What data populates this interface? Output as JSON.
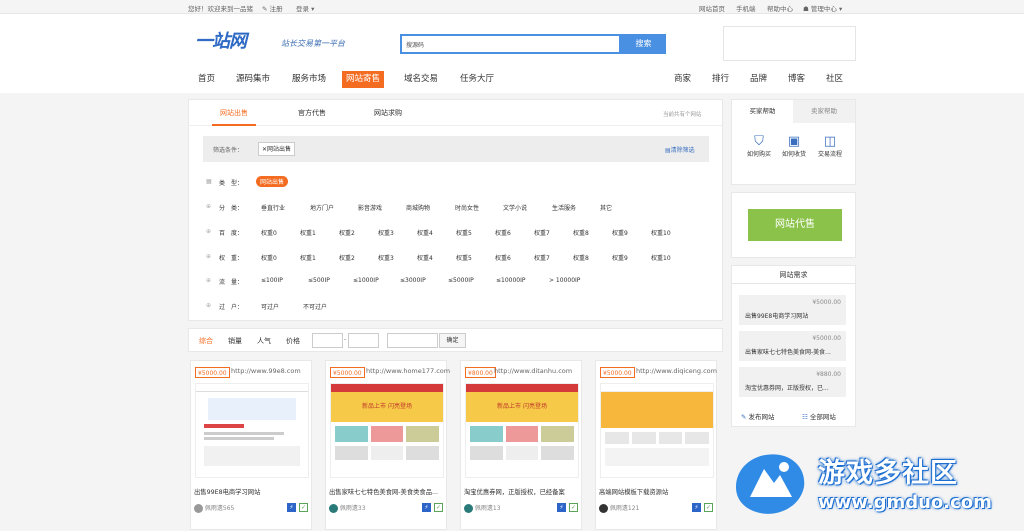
{
  "topbar": {
    "greeting": "您好！欢迎来到一品猪",
    "register": "注册",
    "login": "登录",
    "links": [
      "网站首页",
      "手机端",
      "帮助中心",
      "管理中心"
    ]
  },
  "brand": {
    "logo": "一站网",
    "slogan": "站长交易第一平台"
  },
  "search": {
    "value": "搜源码",
    "button": "搜索"
  },
  "nav": {
    "left": [
      "首页",
      "源码集市",
      "服务市场",
      "网站寄售",
      "域名交易",
      "任务大厅"
    ],
    "right": [
      "商家",
      "排行",
      "品牌",
      "博客",
      "社区"
    ]
  },
  "tabs": [
    "网站出售",
    "官方代售",
    "网站求购"
  ],
  "tabs_note": "当前共有个网站",
  "filter": {
    "label": "筛选条件：",
    "chip": "网站出售",
    "clear": "清除筛选"
  },
  "rows": [
    {
      "label": "类　型：",
      "items": [
        "网站出售"
      ]
    },
    {
      "label": "分　类：",
      "items": [
        "垂直行业",
        "地方门户",
        "影音游戏",
        "商城购物",
        "时尚女性",
        "文学小说",
        "生活服务",
        "其它"
      ]
    },
    {
      "label": "百　度：",
      "items": [
        "权重0",
        "权重1",
        "权重2",
        "权重3",
        "权重4",
        "权重5",
        "权重6",
        "权重7",
        "权重8",
        "权重9",
        "权重10"
      ]
    },
    {
      "label": "权　重：",
      "items": [
        "权重0",
        "权重1",
        "权重2",
        "权重3",
        "权重4",
        "权重5",
        "权重6",
        "权重7",
        "权重8",
        "权重9",
        "权重10"
      ]
    },
    {
      "label": "流　量：",
      "items": [
        "≤100IP",
        "≤500IP",
        "≤1000IP",
        "≤3000IP",
        "≤5000IP",
        "≤10000IP",
        "> 10000IP"
      ]
    },
    {
      "label": "过　户：",
      "items": [
        "可过户",
        "不可过户"
      ]
    }
  ],
  "sort": {
    "items": [
      "综合",
      "销量",
      "人气",
      "价格"
    ],
    "dash": "-",
    "confirm": "确定"
  },
  "cards": [
    {
      "price": "¥5000.00",
      "url": "http://www.99e8.com",
      "title": "出售99E8电商学习网站",
      "user": "佩雨遗565"
    },
    {
      "price": "¥5000.00",
      "url": "http://www.home177.com",
      "title": "出售家味七七特色美食网-美食类食品...",
      "user": "佩雨遗33"
    },
    {
      "price": "¥800.00",
      "url": "http://www.ditanhu.com",
      "title": "淘宝优惠券网，正版授权，已经备案",
      "user": "佩雨遗13"
    },
    {
      "price": "¥5000.00",
      "url": "http://www.diqiceng.com",
      "title": "高端网站模板下载资源站",
      "user": "佩雨遗121"
    }
  ],
  "thumb_banner": "新品上市 闪亮登场",
  "help": {
    "tabs": [
      "买家帮助",
      "卖家帮助"
    ],
    "items": [
      "如何购买",
      "如何收货",
      "交易流程"
    ]
  },
  "agent_button": "网站代售",
  "demand": {
    "title": "网站需求",
    "items": [
      {
        "price": "¥5000.00",
        "text": "出售99E8电商学习网站"
      },
      {
        "price": "¥5000.00",
        "text": "出售家味七七特色美食网-美食..."
      },
      {
        "price": "¥880.00",
        "text": "淘宝优惠券网，正版授权，已..."
      }
    ],
    "publish": "发布网站",
    "all": "全部网站"
  },
  "watermark": {
    "cn": "游戏多社区",
    "url": "www.gmduo.com"
  },
  "colors": {
    "accent": "#f36c21",
    "blue": "#4a90e2",
    "green": "#8bc34a"
  }
}
